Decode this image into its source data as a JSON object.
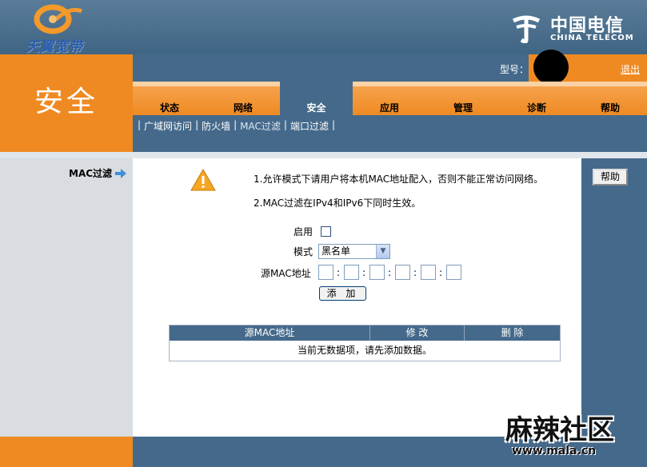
{
  "header": {
    "brand_name": "天翼宽带",
    "telecom_cn": "中国电信",
    "telecom_en": "CHINA TELECOM"
  },
  "section_title": "安全",
  "info_bar": {
    "model_label": "型号：",
    "logout": "退出"
  },
  "tabs": [
    {
      "label": "状态",
      "active": false
    },
    {
      "label": "网络",
      "active": false
    },
    {
      "label": "安全",
      "active": true
    },
    {
      "label": "应用",
      "active": false
    },
    {
      "label": "管理",
      "active": false
    },
    {
      "label": "诊断",
      "active": false
    },
    {
      "label": "帮助",
      "active": false
    }
  ],
  "subnav": {
    "items": [
      "广域网访问",
      "防火墙",
      "MAC过滤",
      "端口过滤"
    ],
    "active": "MAC过滤"
  },
  "left_menu": {
    "current": "MAC过滤",
    "arrow_icon": "arrow-right-icon"
  },
  "help_button": "帮助",
  "notes": {
    "line1": "1.允许模式下请用户将本机MAC地址配入，否则不能正常访问网络。",
    "line2": "2.MAC过滤在IPv4和IPv6下同时生效。"
  },
  "form": {
    "enable_label": "启用",
    "enable_checked": false,
    "mode_label": "模式",
    "mode_value": "黑名单",
    "mac_label": "源MAC地址",
    "mac_octets": [
      "",
      "",
      "",
      "",
      "",
      ""
    ],
    "mac_separator": ":",
    "add_button": "添 加"
  },
  "table": {
    "headers": [
      "源MAC地址",
      "修 改",
      "删 除"
    ],
    "empty_message": "当前无数据项，请先添加数据。"
  },
  "watermark": {
    "main": "麻辣社区",
    "url": "www.mala.cn"
  },
  "colors": {
    "orange": "#ef8a22",
    "steel_blue": "#45698a",
    "light_gray": "#d9dde2"
  }
}
